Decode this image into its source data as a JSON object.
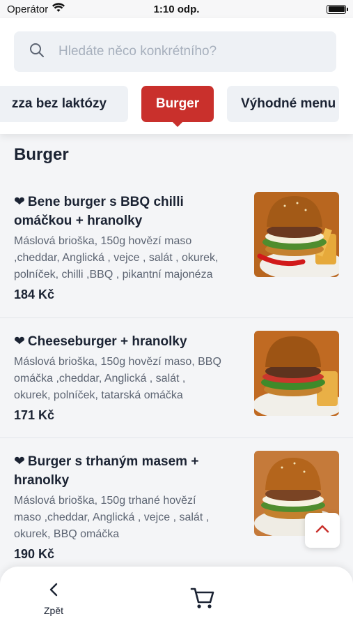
{
  "status_bar": {
    "carrier": "Operátor",
    "time": "1:10 odp.",
    "icons": [
      "wifi-icon",
      "battery-icon"
    ]
  },
  "search": {
    "placeholder": "Hledáte něco konkrétního?",
    "value": ""
  },
  "categories": {
    "items": [
      "zza bez laktózy",
      "Burger",
      "Výhodné menu"
    ],
    "selected": "Burger"
  },
  "section": {
    "title": "Burger"
  },
  "menu_items": [
    {
      "name_line1": "Bene burger s BBQ chilli",
      "name_line2": "omáčkou + hranolky",
      "desc_lines": [
        "Máslová brioška, 150g hovězí maso",
        ",cheddar, Anglická , vejce , salát , okurek,",
        "polníček, chilli ,BBQ , pikantní majonéza"
      ],
      "price": "184 Kč",
      "favorite_icon": "heart-icon"
    },
    {
      "name_line1": "Cheeseburger + hranolky",
      "name_line2": "",
      "desc_lines": [
        "Máslová brioška, 150g hovězí maso, BBQ",
        "omáčka ,cheddar, Anglická , salát ,",
        "okurek, polníček, tatarská omáčka"
      ],
      "price": "171 Kč",
      "favorite_icon": "heart-icon"
    },
    {
      "name_line1": "Burger s trhaným masem +",
      "name_line2": "hranolky",
      "desc_lines": [
        "Máslová brioška, 150g trhané hovězí",
        "maso ,cheddar, Anglická , vejce , salát ,",
        "okurek, BBQ omáčka"
      ],
      "price": "190 Kč",
      "favorite_icon": "heart-icon"
    }
  ],
  "bottom_bar": {
    "back_label": "Zpět",
    "cart_icon": "cart-icon"
  },
  "colors": {
    "accent": "#c9302c",
    "text": "#1b2333",
    "muted_text": "#5c6472",
    "chip_bg": "#eef1f5"
  }
}
